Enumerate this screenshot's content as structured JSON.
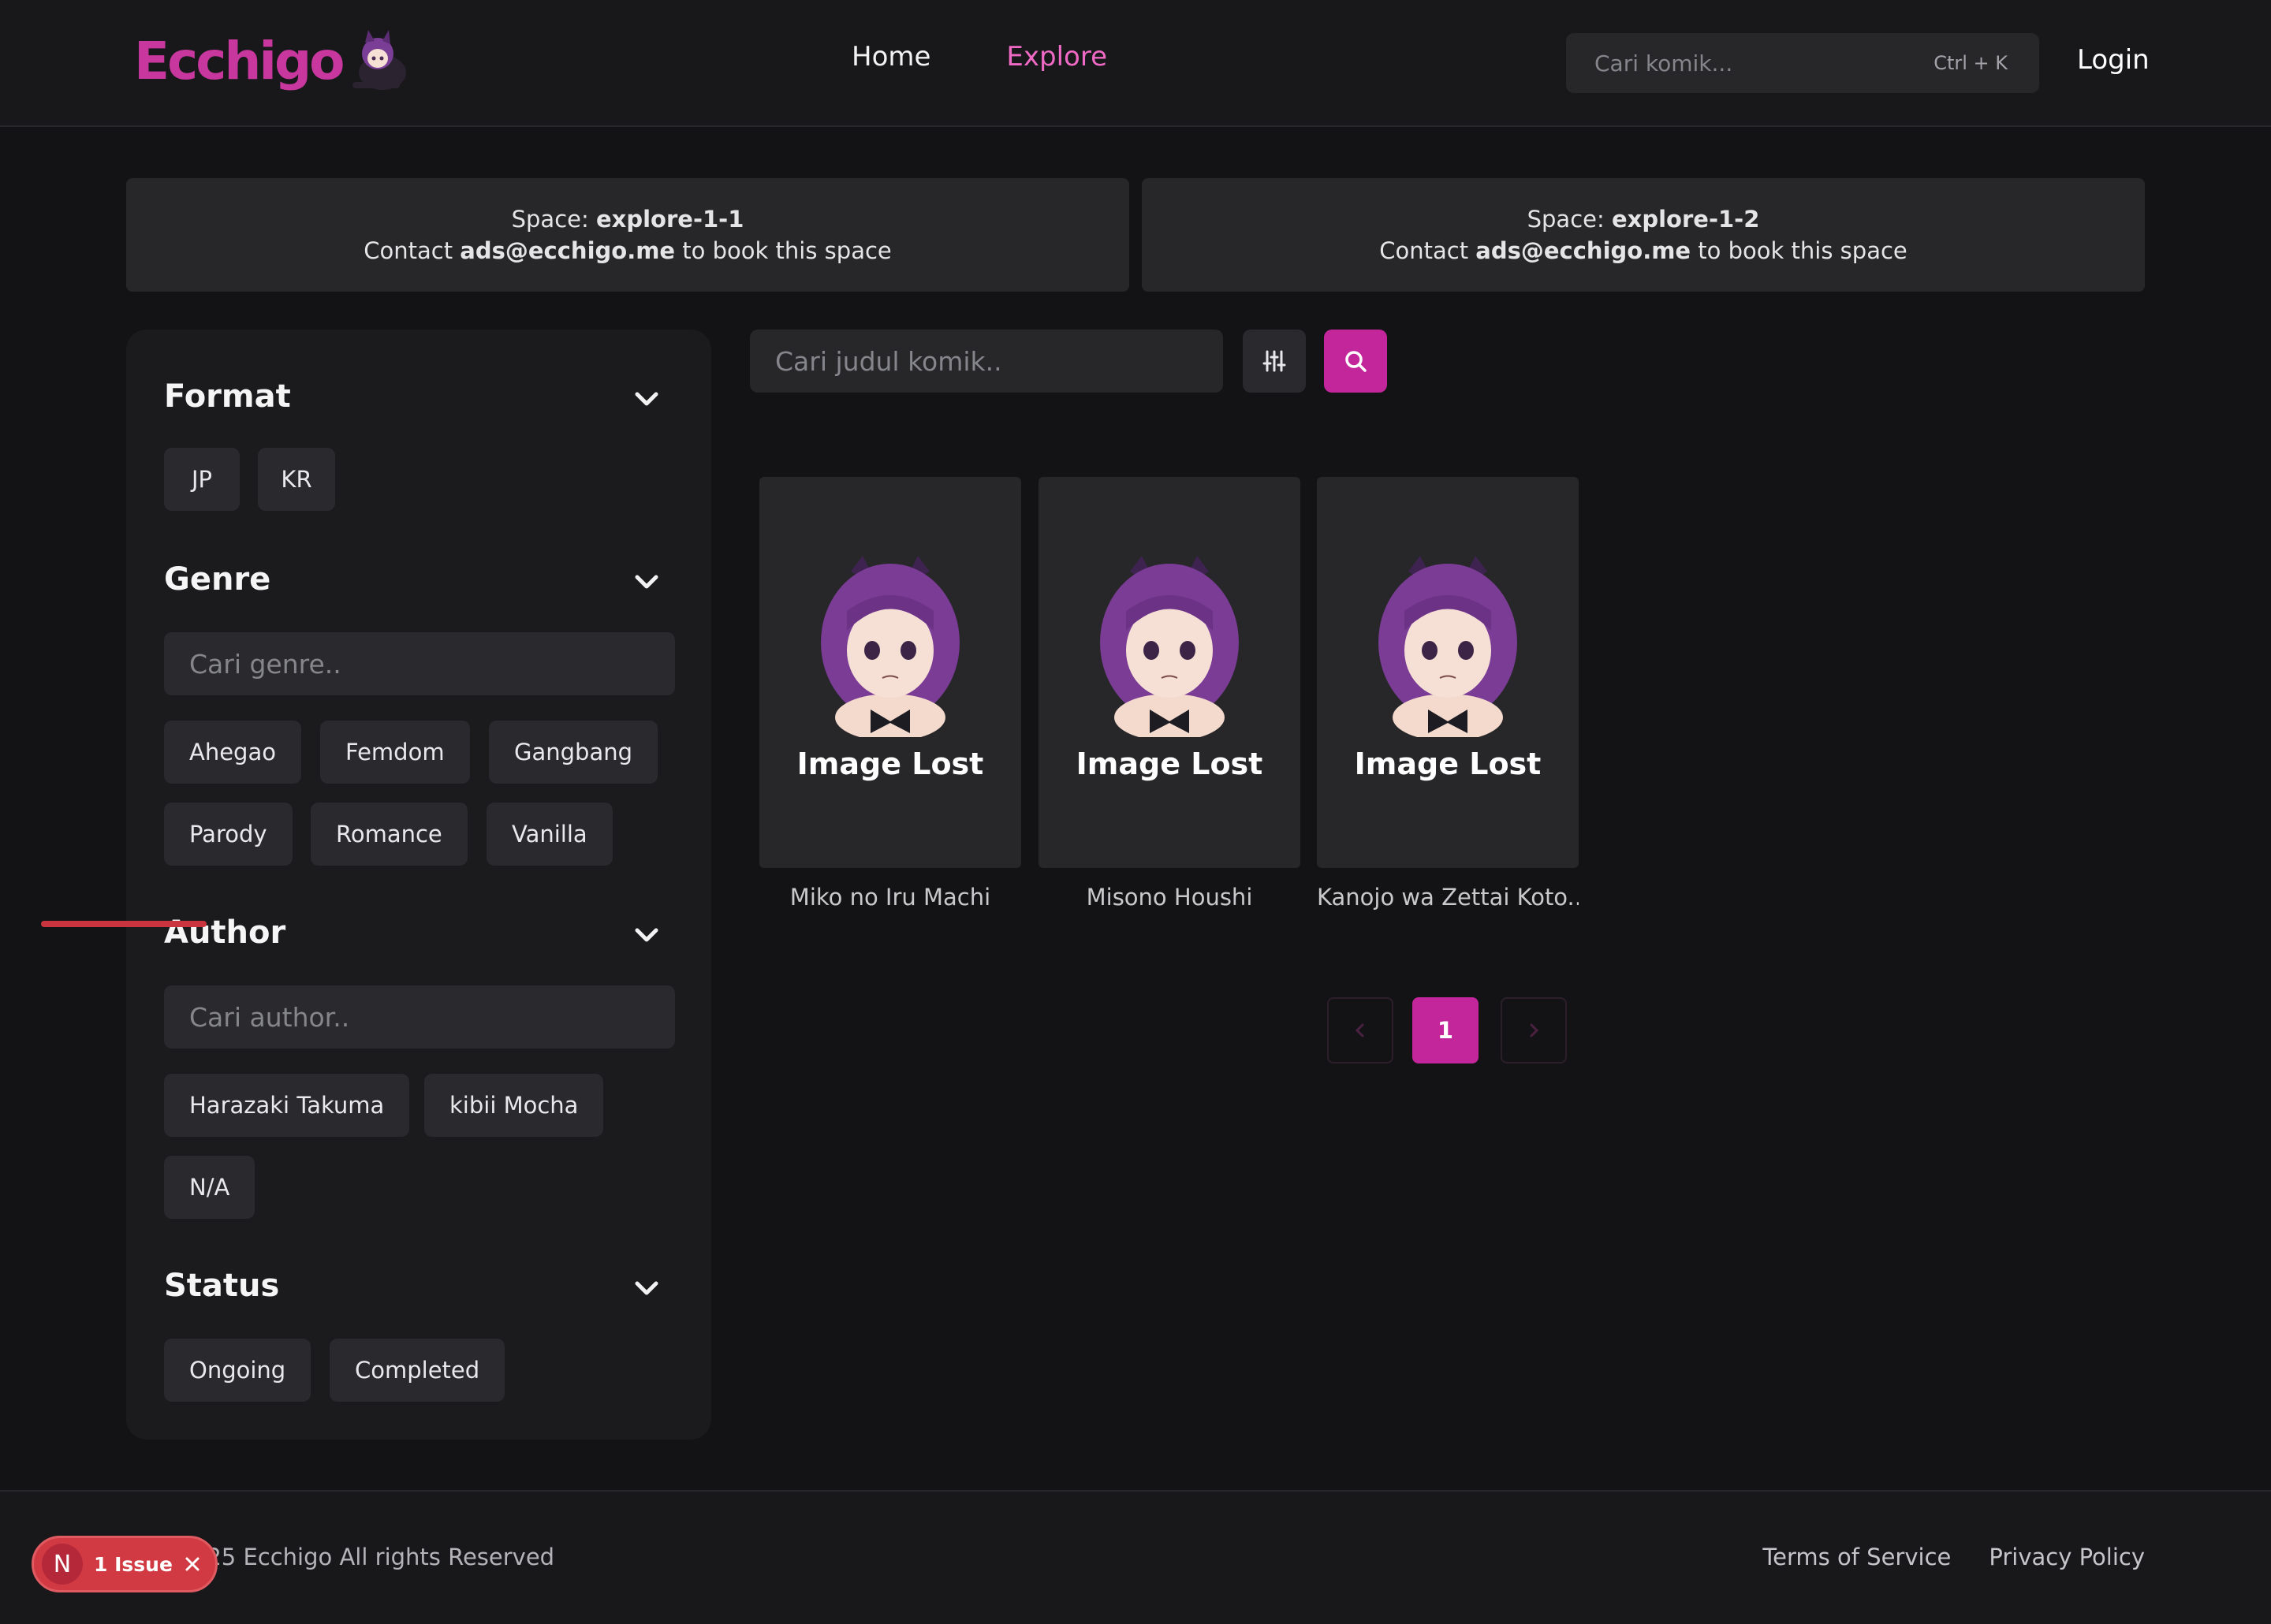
{
  "header": {
    "logo_text": "Ecchigo",
    "nav": [
      {
        "label": "Home",
        "active": false
      },
      {
        "label": "Explore",
        "active": true
      }
    ],
    "search_placeholder": "Cari komik...",
    "search_shortcut": "Ctrl + K",
    "login_label": "Login"
  },
  "ads": [
    {
      "prefix": "Space: ",
      "space": "explore-1-1",
      "contact_prefix": "Contact ",
      "email": "ads@ecchigo.me",
      "contact_suffix": " to book this space"
    },
    {
      "prefix": "Space: ",
      "space": "explore-1-2",
      "contact_prefix": "Contact ",
      "email": "ads@ecchigo.me",
      "contact_suffix": " to book this space"
    }
  ],
  "sidebar": {
    "format": {
      "title": "Format",
      "options": [
        "JP",
        "KR"
      ]
    },
    "genre": {
      "title": "Genre",
      "placeholder": "Cari genre..",
      "options": [
        "Ahegao",
        "Femdom",
        "Gangbang",
        "Parody",
        "Romance",
        "Vanilla"
      ]
    },
    "author": {
      "title": "Author",
      "placeholder": "Cari author..",
      "options": [
        "Harazaki Takuma",
        "kibii Mocha",
        "N/A"
      ]
    },
    "status": {
      "title": "Status",
      "options": [
        "Ongoing",
        "Completed"
      ]
    }
  },
  "main": {
    "search_placeholder": "Cari judul komik..",
    "cards": [
      {
        "cover_text": "Image Lost",
        "title": "Miko no Iru Machi"
      },
      {
        "cover_text": "Image Lost",
        "title": "Misono Houshi"
      },
      {
        "cover_text": "Image Lost",
        "title": "Kanojo wa Zettai Koto..."
      }
    ],
    "pagination": {
      "current": "1"
    }
  },
  "footer": {
    "copyright": "ight 2025 Ecchigo All rights Reserved",
    "links": [
      "Terms of Service",
      "Privacy Policy"
    ]
  },
  "dev_badge": {
    "letter": "N",
    "label": "1 Issue"
  },
  "colors": {
    "accent": "#c2269a",
    "nav_active": "#f06ac5",
    "background": "#131316"
  }
}
